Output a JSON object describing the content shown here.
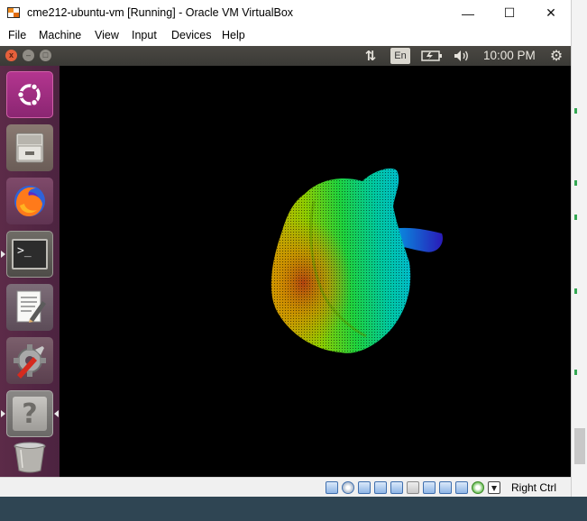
{
  "window": {
    "title": "cme212-ubuntu-vm [Running] - Oracle VM VirtualBox",
    "minimize_symbol": "—",
    "maximize_symbol": "☐",
    "close_symbol": "✕"
  },
  "menu": {
    "items": [
      "File",
      "Machine",
      "View",
      "Input",
      "Devices",
      "Help"
    ]
  },
  "ubuntu_panel": {
    "close_symbol": "x",
    "minimize_symbol": "–",
    "maximize_symbol": "□",
    "network_symbol": "⇅",
    "language": "En",
    "battery_symbol": "▭",
    "volume_symbol": "🔊",
    "time": "10:00 PM",
    "settings_symbol": "⚙"
  },
  "launcher": {
    "items": [
      {
        "name": "ubuntu-dash",
        "icon": "ubuntu-logo-icon"
      },
      {
        "name": "files",
        "icon": "file-cabinet-icon"
      },
      {
        "name": "firefox",
        "icon": "firefox-icon"
      },
      {
        "name": "terminal",
        "icon": "terminal-icon",
        "prompt": ">_"
      },
      {
        "name": "text-editor",
        "icon": "text-editor-icon"
      },
      {
        "name": "system-settings",
        "icon": "settings-tools-icon"
      },
      {
        "name": "help",
        "icon": "help-icon",
        "symbol": "?"
      },
      {
        "name": "trash",
        "icon": "trash-icon"
      }
    ]
  },
  "statusbar": {
    "host_key": "Right Ctrl",
    "icons": [
      "hard-disk-icon",
      "optical-drive-icon",
      "audio-icon",
      "network-icon",
      "usb-icon",
      "shared-folders-icon",
      "display-icon",
      "video-capture-icon",
      "cpu-icon",
      "mouse-integration-icon",
      "host-key-arrow-icon"
    ]
  },
  "colors": {
    "launcher_bg": "#5c2b48",
    "panel_bg": "#3c3b37",
    "accent_close": "#e5603b",
    "screen_bg": "#000000",
    "host_taskbar": "#2f4553"
  }
}
